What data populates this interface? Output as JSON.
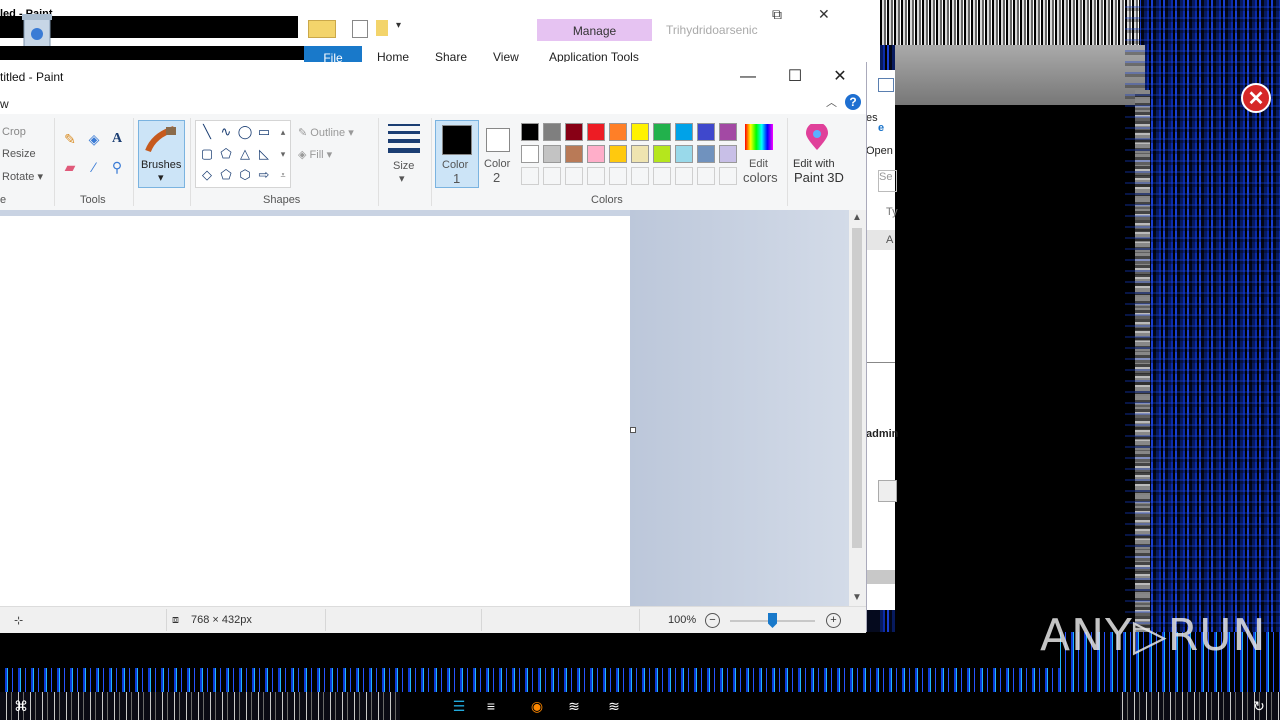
{
  "explorer": {
    "title_fragment": "led - Paint",
    "manage_tab": "Manage",
    "context_title": "Trihydridoarsenic",
    "tabs": [
      "File",
      "Home",
      "Share",
      "View",
      "Application Tools"
    ]
  },
  "paint": {
    "title": "titled - Paint",
    "view_tab": "w",
    "image_group": {
      "crop": "Crop",
      "resize": "Resize",
      "rotate": "Rotate",
      "label": "e"
    },
    "tools_label": "Tools",
    "brushes_label": "Brushes",
    "shapes": {
      "outline": "Outline",
      "fill": "Fill",
      "label": "Shapes"
    },
    "size_label": "Size",
    "color1": {
      "line1": "Color",
      "line2": "1"
    },
    "color2": {
      "line1": "Color",
      "line2": "2"
    },
    "colors_label": "Colors",
    "edit_colors": {
      "line1": "Edit",
      "line2": "colors"
    },
    "edit_paint3d": {
      "line1": "Edit with",
      "line2": "Paint 3D"
    },
    "palette_row1": [
      "#000000",
      "#7f7f7f",
      "#880015",
      "#ed1c24",
      "#ff7f27",
      "#fff200",
      "#22b14c",
      "#00a2e8",
      "#3f48cc",
      "#a349a4"
    ],
    "palette_row2": [
      "#ffffff",
      "#c3c3c3",
      "#b97a57",
      "#ffaec9",
      "#ffc90e",
      "#efe4b0",
      "#b5e61d",
      "#99d9ea",
      "#7092be",
      "#c8bfe7"
    ],
    "status": {
      "dimensions": "768 × 432px",
      "zoom": "100%"
    }
  },
  "side_window": {
    "open_label": "Open",
    "admin_label": "admin",
    "s_label": "Se",
    "t_label": "Ty",
    "a_label": "A",
    "es_label": "es"
  },
  "watermark": {
    "text": "ANY▷RUN"
  }
}
